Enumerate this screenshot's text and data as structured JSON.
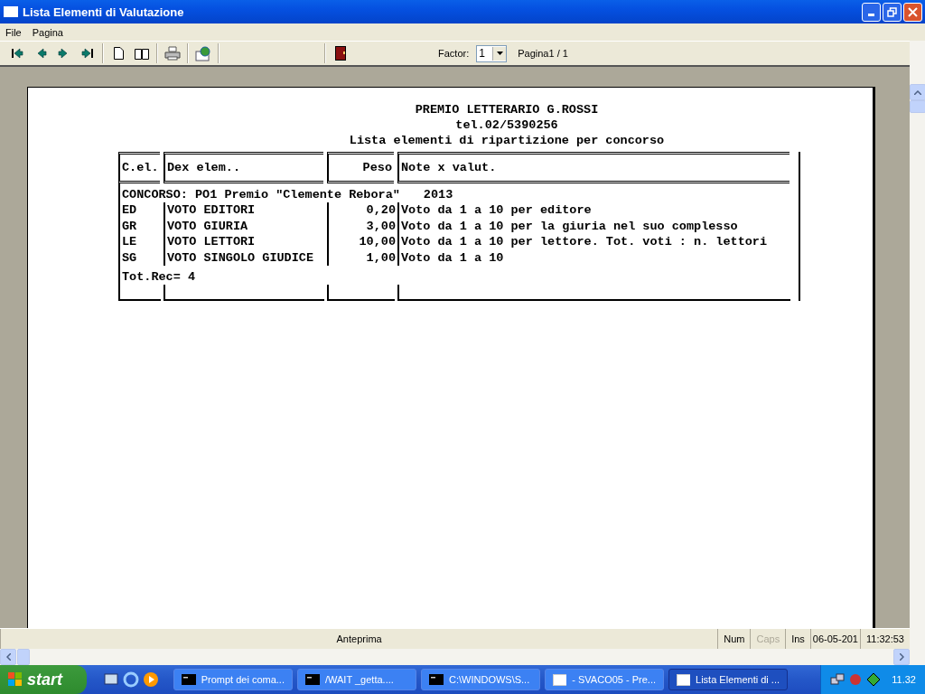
{
  "window": {
    "title": "Lista Elementi di Valutazione"
  },
  "menu": [
    "File",
    "Pagina"
  ],
  "toolbar": {
    "factor_label": "Factor:",
    "factor_value": "1",
    "page_info": "Pagina1 / 1"
  },
  "report": {
    "title_lines": [
      "PREMIO LETTERARIO G.ROSSI",
      "tel.02/5390256",
      "Lista elementi di ripartizione per concorso"
    ],
    "columns": [
      "C.el.",
      "Dex elem..",
      "Peso",
      "Note x valut."
    ],
    "group": {
      "label": "CONCORSO: PO1 Premio \"Clemente Rebora\"",
      "year": "2013"
    },
    "rows": [
      {
        "code": "ED",
        "name": "VOTO EDITORI",
        "weight": "0,20",
        "note": "Voto da 1 a 10 per editore"
      },
      {
        "code": "GR",
        "name": "VOTO GIURIA",
        "weight": "3,00",
        "note": "Voto da 1 a 10 per la giuria nel suo complesso"
      },
      {
        "code": "LE",
        "name": "VOTO LETTORI",
        "weight": "10,00",
        "note": "Voto da 1 a 10 per lettore. Tot. voti : n. lettori"
      },
      {
        "code": "SG",
        "name": "VOTO SINGOLO GIUDICE",
        "weight": "1,00",
        "note": "Voto da 1 a 10"
      }
    ],
    "footer": "Tot.Rec= 4"
  },
  "status_bar": {
    "message": "Anteprima",
    "indicators": [
      {
        "label": "Num",
        "active": true
      },
      {
        "label": "Caps",
        "active": false
      },
      {
        "label": "Ins",
        "active": true
      }
    ],
    "date": "06-05-201",
    "time": "11:32:53"
  },
  "taskbar": {
    "start": "start",
    "tasks": [
      {
        "label": "Prompt dei coma...",
        "kind": "console",
        "selected": false
      },
      {
        "label": "/WAIT _getta....",
        "kind": "console",
        "selected": false
      },
      {
        "label": "C:\\WINDOWS\\S...",
        "kind": "console",
        "selected": false
      },
      {
        "label": "- SVACO05 - Pre...",
        "kind": "window",
        "selected": false
      },
      {
        "label": "Lista Elementi di ...",
        "kind": "window",
        "selected": true
      }
    ],
    "clock": "11.32"
  }
}
